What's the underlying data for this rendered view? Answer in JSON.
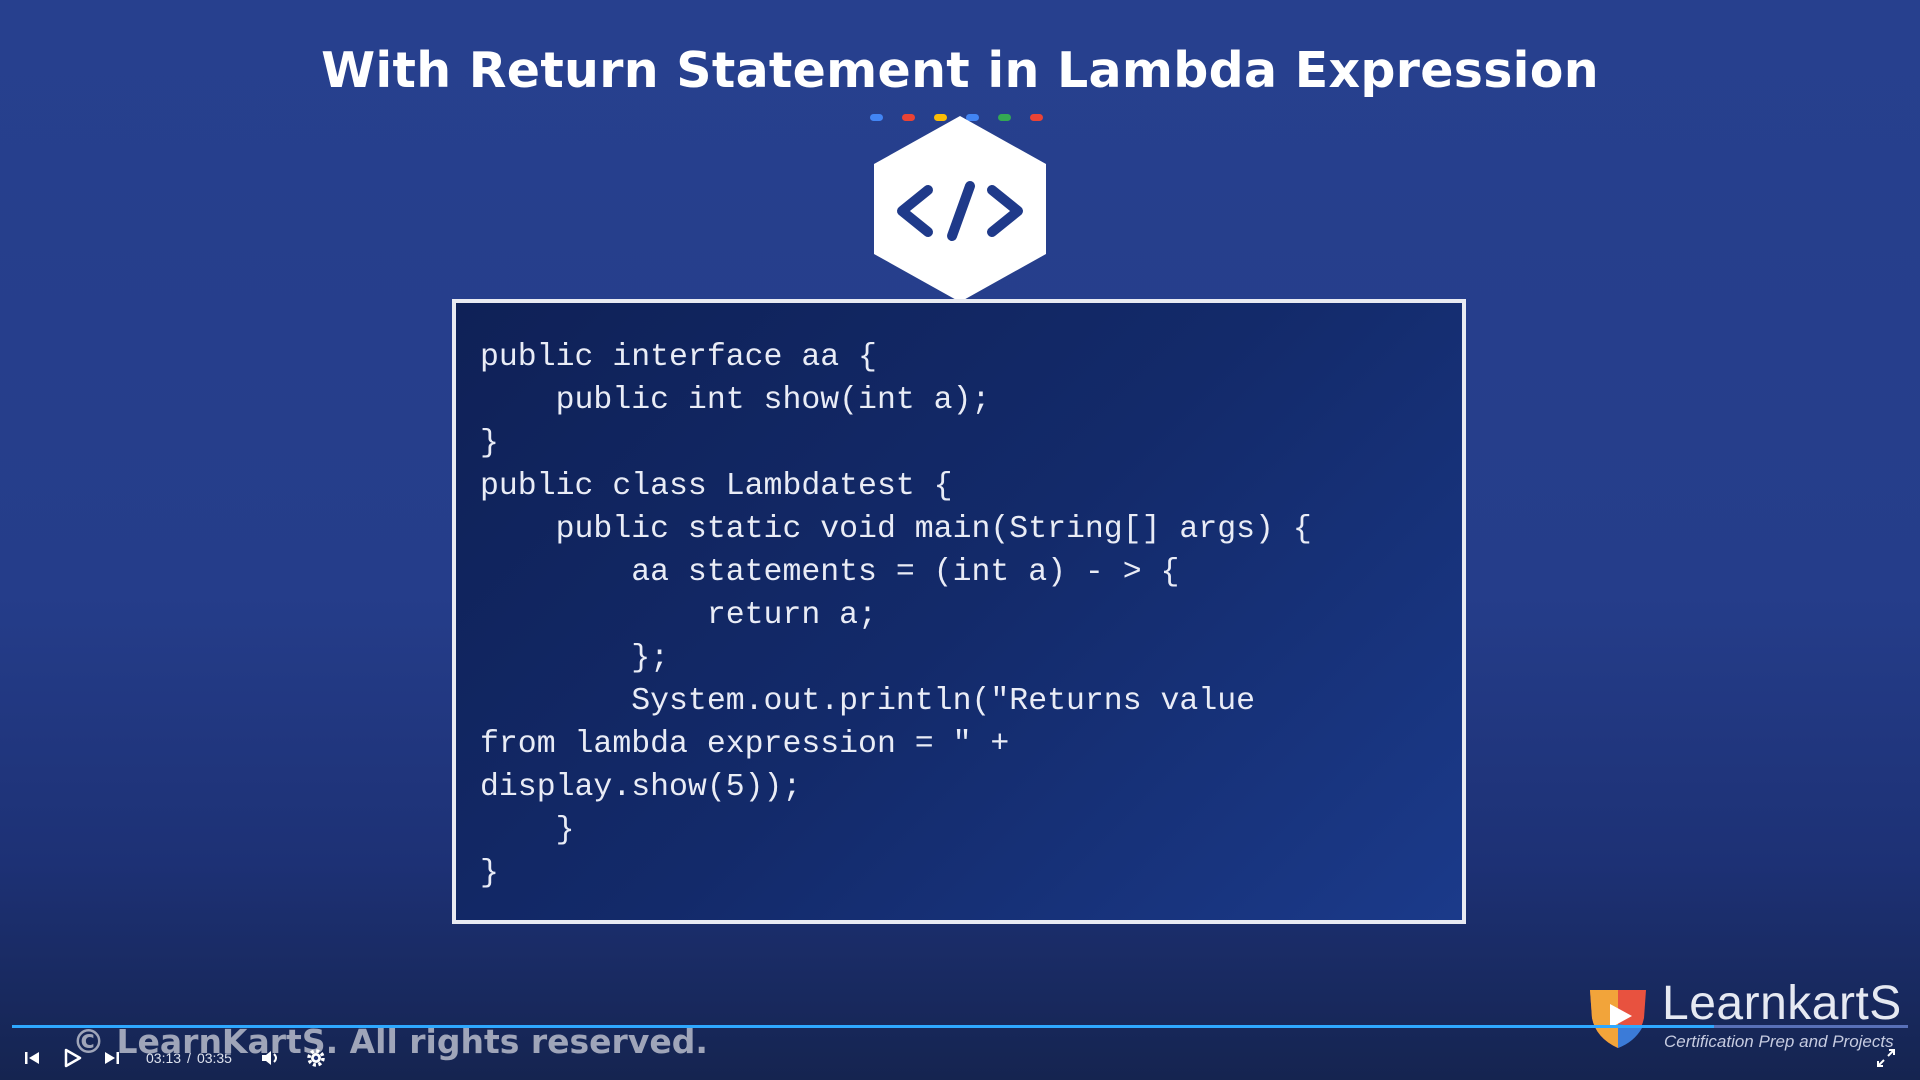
{
  "slide": {
    "title": "With Return Statement in Lambda Expression",
    "icon": "code-brackets-icon",
    "dot_colors": [
      "#4285f4",
      "#ea4335",
      "#fbbc05",
      "#4285f4",
      "#34a853",
      "#ea4335"
    ],
    "code_lines": [
      "public interface aa {",
      "    public int show(int a);",
      "}",
      "public class Lambdatest {",
      "    public static void main(String[] args) {",
      "        aa statements = (int a) - > {",
      "            return a;",
      "        };",
      "        System.out.println(\"Returns value",
      "from lambda expression = \" +",
      "display.show(5));",
      "    }",
      "}"
    ],
    "copyright": "© LearnKartS. All rights reserved."
  },
  "brand": {
    "name": "LearnkartS",
    "tagline": "Certification Prep and Projects",
    "logo_colors": [
      "#e8523f",
      "#f2a43a",
      "#3b7bd8"
    ]
  },
  "player": {
    "current_time": "03:13",
    "separator": "/",
    "duration": "03:35",
    "progress": 0.8977,
    "accent": "#2ea8ff",
    "controls": [
      "previous-icon",
      "play-icon",
      "next-icon",
      "volume-icon",
      "settings-icon",
      "fullscreen-icon"
    ]
  }
}
